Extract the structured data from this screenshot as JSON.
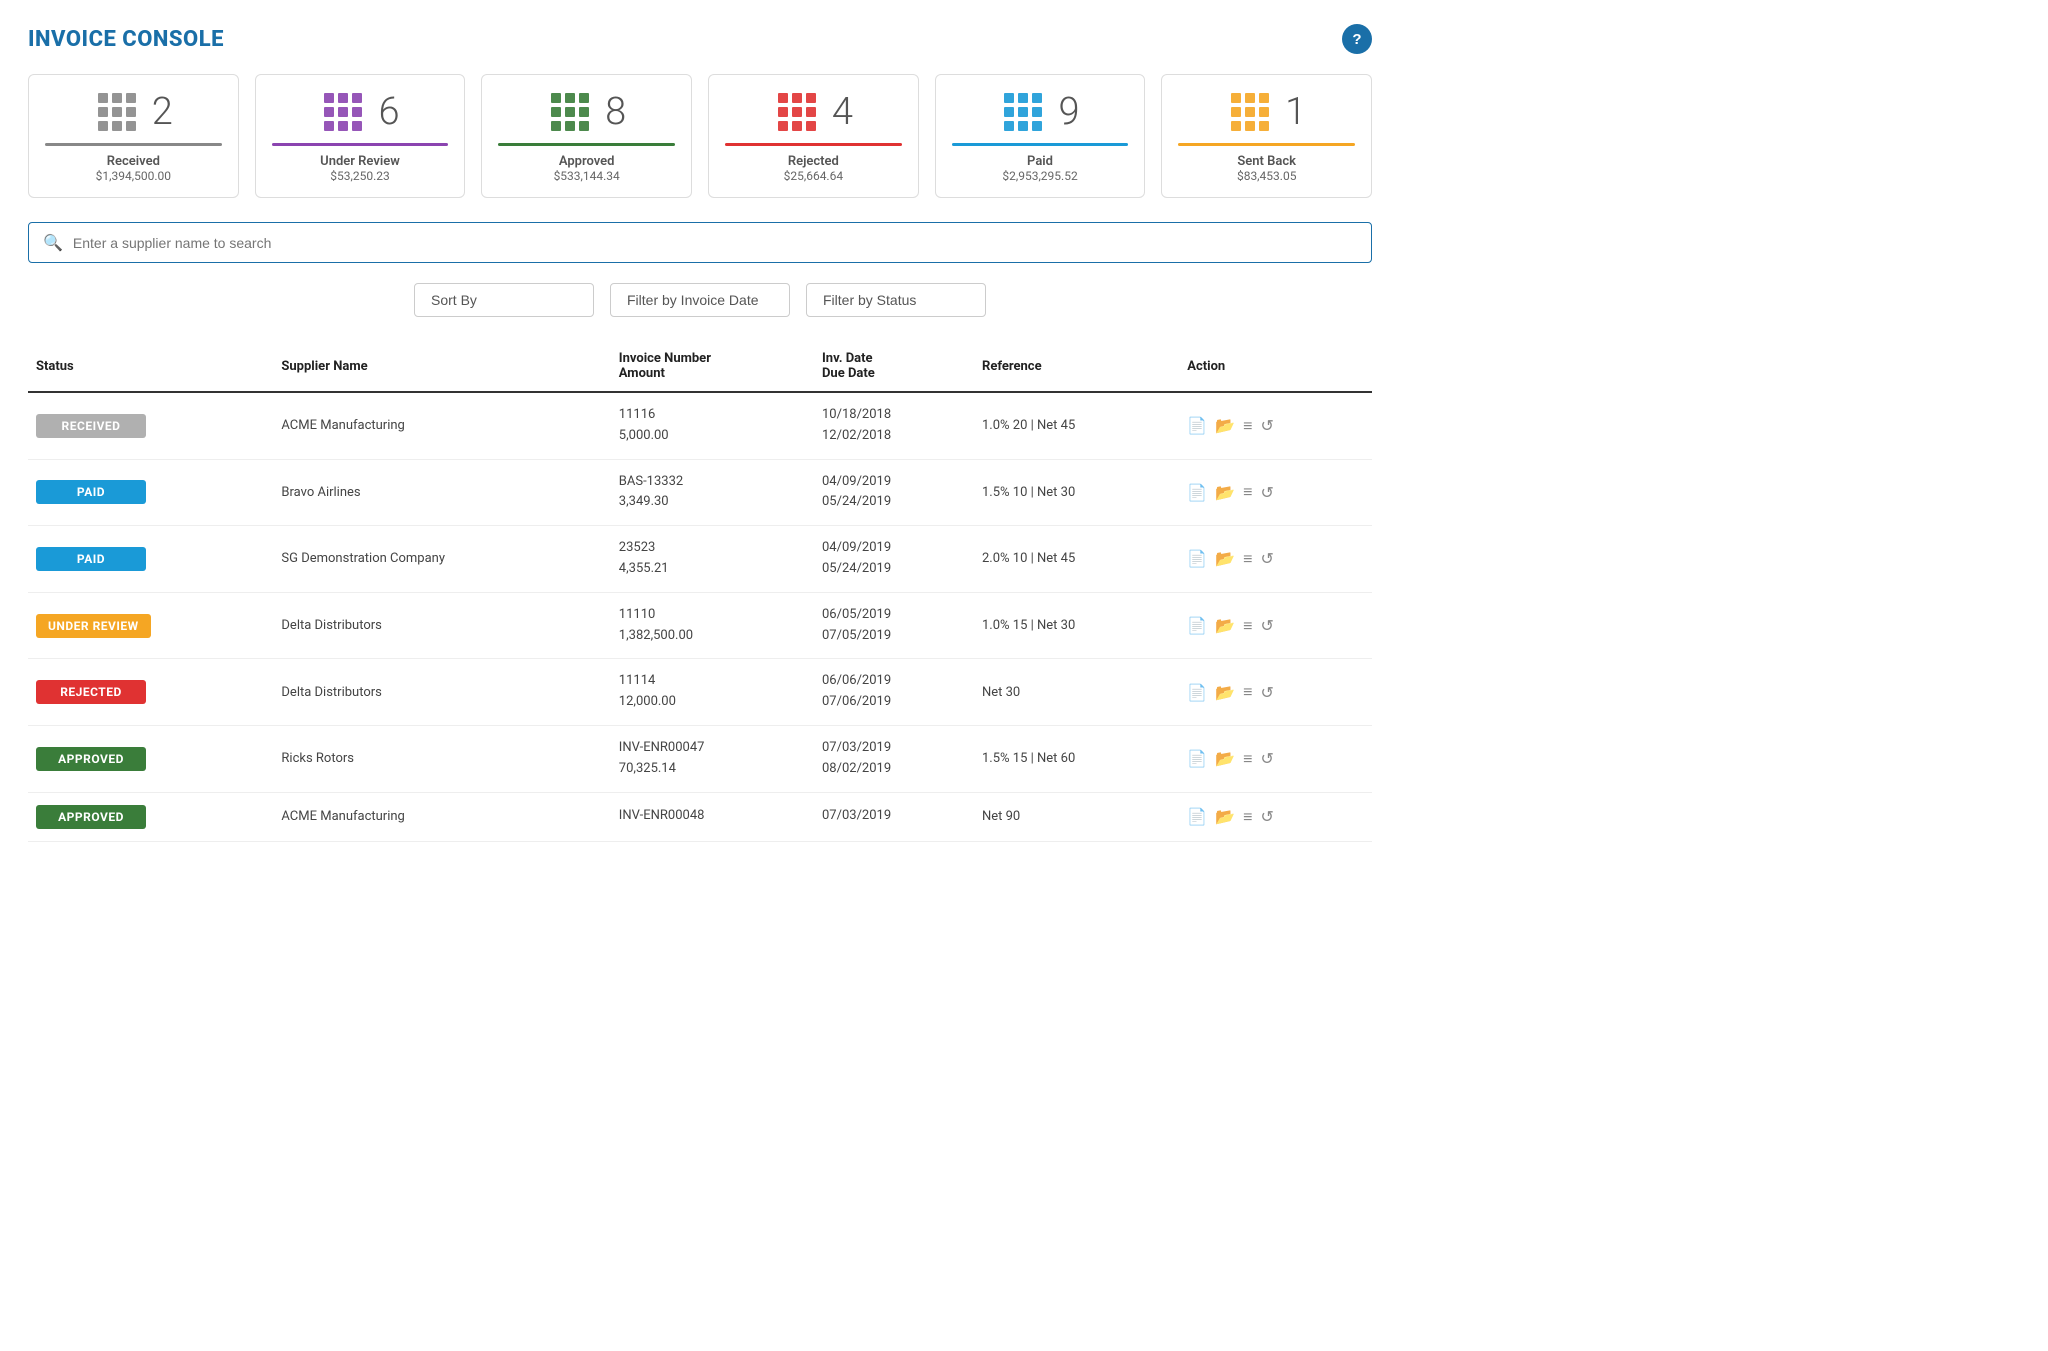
{
  "header": {
    "title": "INVOICE CONSOLE",
    "help_label": "?"
  },
  "stats": [
    {
      "id": "received",
      "count": "2",
      "label": "Received",
      "amount": "$1,394,500.00",
      "color": "#888888",
      "icon_color": "#888888"
    },
    {
      "id": "under-review",
      "count": "6",
      "label": "Under Review",
      "amount": "$53,250.23",
      "color": "#8b44b0",
      "icon_color": "#8b44b0"
    },
    {
      "id": "approved",
      "count": "8",
      "label": "Approved",
      "amount": "$533,144.34",
      "color": "#3a7d3a",
      "icon_color": "#3a7d3a"
    },
    {
      "id": "rejected",
      "count": "4",
      "label": "Rejected",
      "amount": "$25,664.64",
      "color": "#e03232",
      "icon_color": "#e03232"
    },
    {
      "id": "paid",
      "count": "9",
      "label": "Paid",
      "amount": "$2,953,295.52",
      "color": "#1a9ad7",
      "icon_color": "#1a9ad7"
    },
    {
      "id": "sent-back",
      "count": "1",
      "label": "Sent Back",
      "amount": "$83,453.05",
      "color": "#f5a623",
      "icon_color": "#f5a623"
    }
  ],
  "search": {
    "placeholder": "Enter a supplier name to search"
  },
  "filters": {
    "sort_by": "Sort By",
    "filter_date": "Filter by Invoice Date",
    "filter_status": "Filter by Status"
  },
  "table": {
    "headers": [
      "Status",
      "Supplier Name",
      "Invoice Number\nAmount",
      "Inv. Date\nDue Date",
      "Reference",
      "Action"
    ],
    "rows": [
      {
        "status": "RECEIVED",
        "status_class": "badge-received",
        "supplier": "ACME Manufacturing",
        "invoice_number": "11116",
        "amount": "5,000.00",
        "inv_date": "10/18/2018",
        "due_date": "12/02/2018",
        "reference": "1.0% 20 | Net 45"
      },
      {
        "status": "PAID",
        "status_class": "badge-paid",
        "supplier": "Bravo Airlines",
        "invoice_number": "BAS-13332",
        "amount": "3,349.30",
        "inv_date": "04/09/2019",
        "due_date": "05/24/2019",
        "reference": "1.5% 10 | Net 30"
      },
      {
        "status": "PAID",
        "status_class": "badge-paid",
        "supplier": "SG Demonstration Company",
        "invoice_number": "23523",
        "amount": "4,355.21",
        "inv_date": "04/09/2019",
        "due_date": "05/24/2019",
        "reference": "2.0% 10 | Net 45"
      },
      {
        "status": "UNDER REVIEW",
        "status_class": "badge-under-review",
        "supplier": "Delta Distributors",
        "invoice_number": "11110",
        "amount": "1,382,500.00",
        "inv_date": "06/05/2019",
        "due_date": "07/05/2019",
        "reference": "1.0% 15 | Net 30"
      },
      {
        "status": "REJECTED",
        "status_class": "badge-rejected",
        "supplier": "Delta Distributors",
        "invoice_number": "11114",
        "amount": "12,000.00",
        "inv_date": "06/06/2019",
        "due_date": "07/06/2019",
        "reference": "Net 30"
      },
      {
        "status": "APPROVED",
        "status_class": "badge-approved",
        "supplier": "Ricks Rotors",
        "invoice_number": "INV-ENR00047",
        "amount": "70,325.14",
        "inv_date": "07/03/2019",
        "due_date": "08/02/2019",
        "reference": "1.5% 15 | Net 60"
      },
      {
        "status": "APPROVED",
        "status_class": "badge-approved",
        "supplier": "ACME Manufacturing",
        "invoice_number": "INV-ENR00048",
        "amount": "",
        "inv_date": "07/03/2019",
        "due_date": "",
        "reference": "Net 90"
      }
    ]
  }
}
